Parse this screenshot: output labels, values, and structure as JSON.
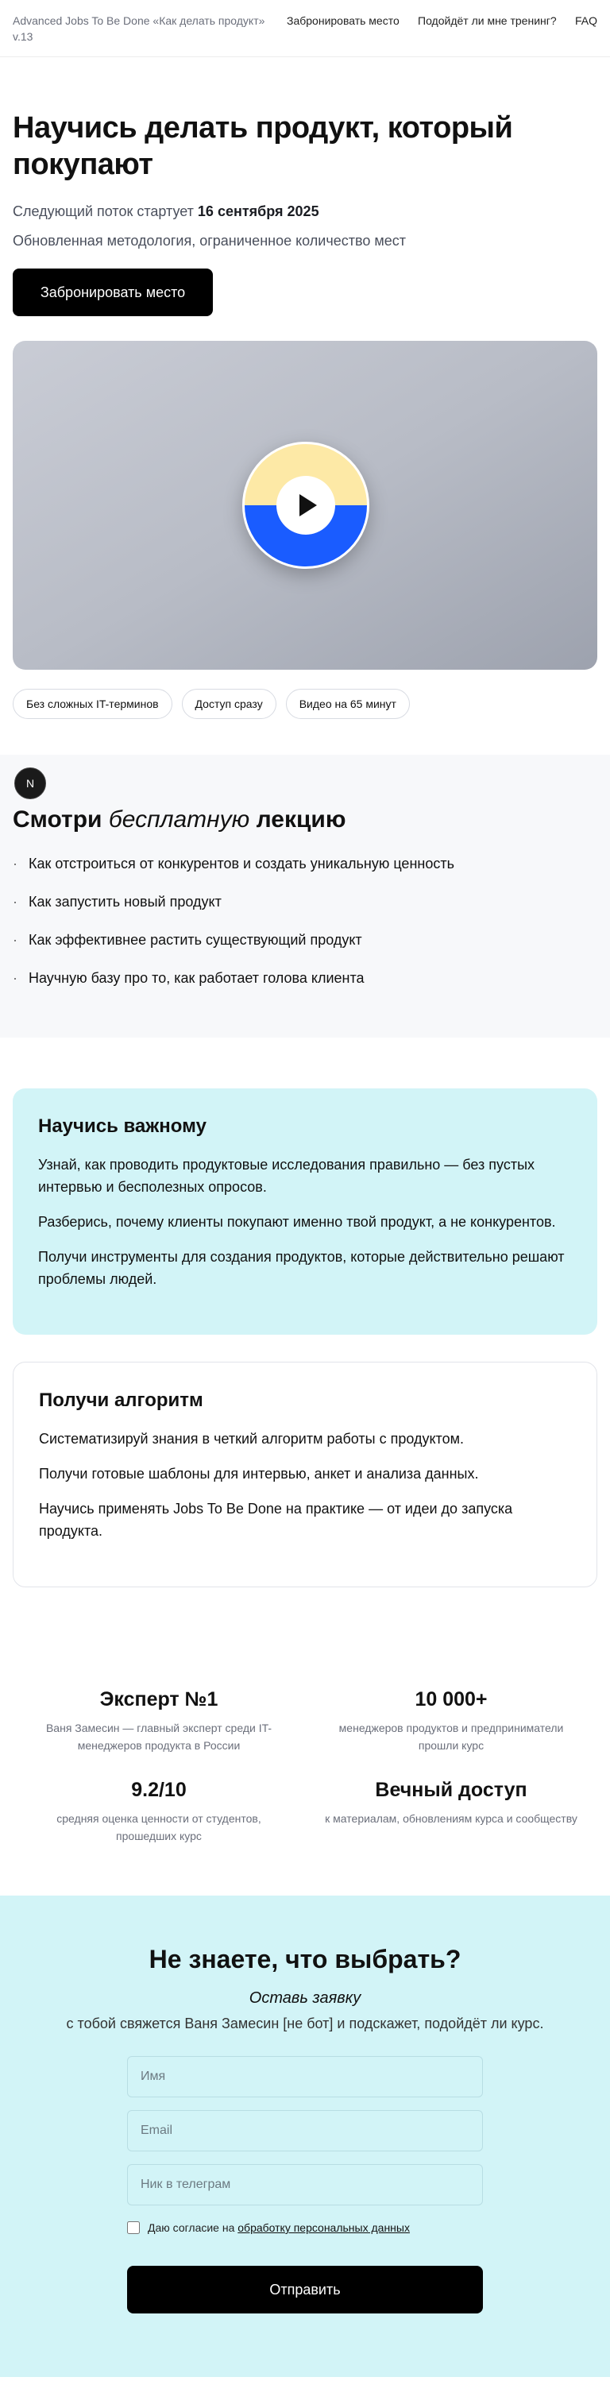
{
  "header": {
    "brand": "Advanced Jobs To Be Done «Как делать продукт» v.13",
    "nav_book": "Забронировать место",
    "nav_fit": "Подойдёт ли мне тренинг?",
    "nav_faq": "FAQ"
  },
  "hero": {
    "title": "Научись делать продукт, который покупают",
    "start_prefix": "Следующий поток стартует",
    "start_date": "16 сентября 2025",
    "note": "Обновленная методология, ограниченное количество мест",
    "cta": "Забронировать место"
  },
  "video": {
    "play_icon": "play-icon",
    "colors": {
      "top": "#fde9a6",
      "bottom": "#1a5cff"
    }
  },
  "chips": [
    "Без сложных IT-терминов",
    "Доступ сразу",
    "Видео на 65 минут"
  ],
  "floating_badge": "N",
  "lecture": {
    "title_pre": "Смотри",
    "title_italic": "бесплатную",
    "title_post": "лекцию",
    "items": [
      "Как отстроиться от конкурентов и создать уникальную ценность",
      "Как запустить новый продукт",
      "Как эффективнее растить существующий продукт",
      "Научную базу про то, как работает голова клиента"
    ]
  },
  "learn": {
    "title": "Научись важному",
    "paragraphs": [
      "Узнай, как проводить продуктовые исследования правильно — без пустых интервью и бесполезных опросов.",
      "Разберись, почему клиенты покупают именно твой продукт, а не конкурентов.",
      "Получи инструменты для создания продуктов, которые действительно решают проблемы людей."
    ]
  },
  "algorithm": {
    "title": "Получи алгоритм",
    "paragraphs": [
      "Систематизируй знания в четкий алгоритм работы с продуктом.",
      "Получи готовые шаблоны для интервью, анкет и анализа данных.",
      "Научись применять Jobs To Be Done на практике — от идеи до запуска продукта."
    ]
  },
  "stats": [
    {
      "value": "Эксперт №1",
      "desc": "Ваня Замесин — главный эксперт среди IT-менеджеров продукта в России"
    },
    {
      "value": "10 000+",
      "desc": "менеджеров продуктов и предприниматели прошли курс"
    },
    {
      "value": "9.2/10",
      "desc": "средняя оценка ценности от студентов, прошедших курс"
    },
    {
      "value": "Вечный доступ",
      "desc": "к материалам, обновлениям курса и сообществу"
    }
  ],
  "form": {
    "title": "Не знаете, что выбрать?",
    "subtitle": "Оставь заявку",
    "desc": "с тобой свяжется Ваня Замесин [не бот] и подскажет, подойдёт ли курс.",
    "name_placeholder": "Имя",
    "email_placeholder": "Email",
    "tg_placeholder": "Ник в телеграм",
    "consent_prefix": "Даю согласие на",
    "consent_link": "обработку персональных данных",
    "submit": "Отправить"
  }
}
